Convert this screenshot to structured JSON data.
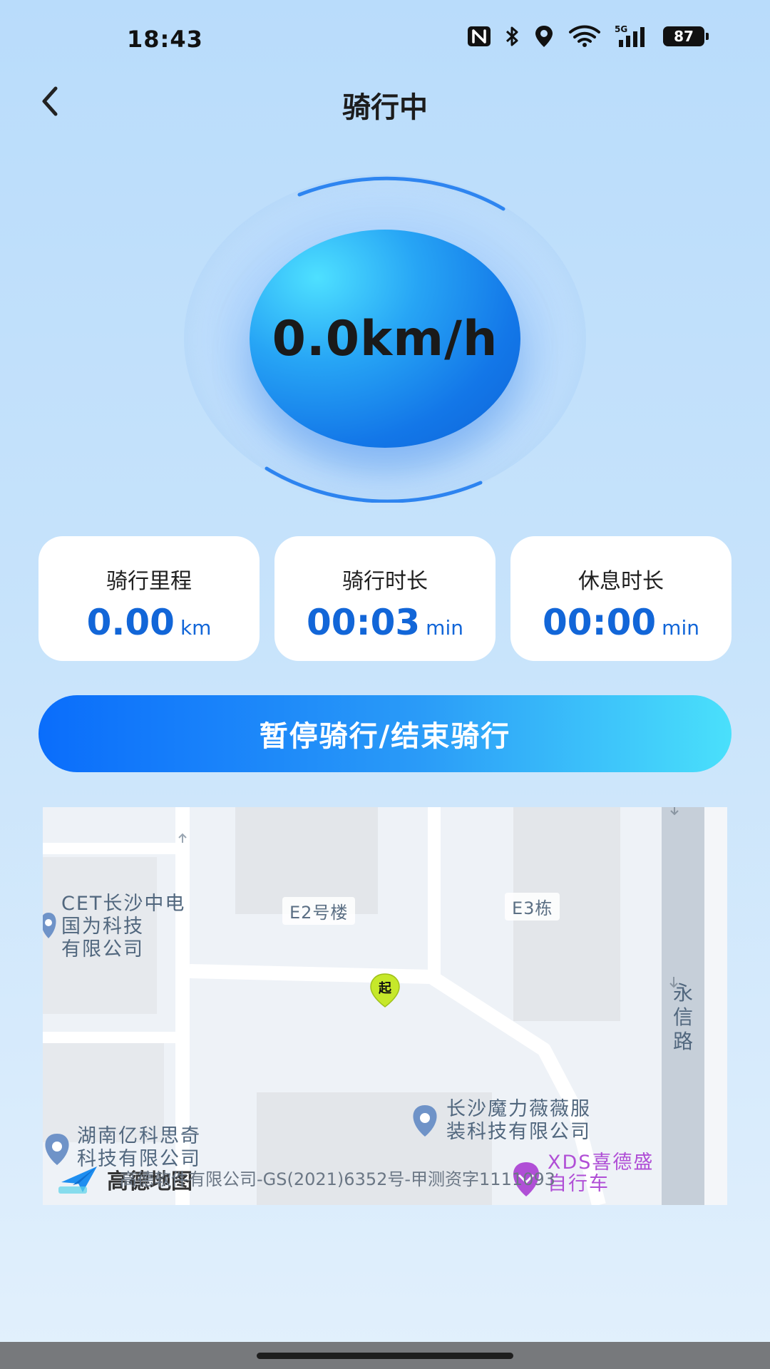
{
  "status_bar": {
    "time": "18:43",
    "network": "5G",
    "battery": "87",
    "icons": [
      "nfc-icon",
      "bluetooth-icon",
      "location-icon",
      "wifi-icon",
      "signal-icon",
      "battery-icon"
    ]
  },
  "header": {
    "title": "骑行中",
    "back_icon": "chevron-left-icon"
  },
  "speed": {
    "value": "0.0km/h"
  },
  "stats": [
    {
      "label": "骑行里程",
      "value": "0.00",
      "unit": "km"
    },
    {
      "label": "骑行时长",
      "value": "00:03",
      "unit": "min"
    },
    {
      "label": "休息时长",
      "value": "00:00",
      "unit": "min"
    }
  ],
  "action_button": {
    "label": "暂停骑行/结束骑行"
  },
  "map": {
    "poi_cet": "CET长沙中电国为科技有限公司",
    "poi_cet_lines": [
      "CET长沙中电",
      "国为科技",
      "有限公司"
    ],
    "tag_e2": "E2号楼",
    "tag_e3": "E3栋",
    "road_vertical": [
      "永",
      "信",
      "路"
    ],
    "start_marker": "起",
    "poi_mlww_lines": [
      "长沙魔力薇薇服",
      "装科技有限公司"
    ],
    "poi_hnyk_lines": [
      "湖南亿科思奇",
      "科技有限公司"
    ],
    "poi_xds_lines": [
      "XDS喜德盛",
      "自行车"
    ],
    "logo_text": "高德地图",
    "copyright": "高德软件有限公司-GS(2021)6352号-甲测资字1111093",
    "colors": {
      "start_marker": "#c6e82a",
      "poi_purple": "#b04fd6",
      "poi_blue": "#6f93c8"
    }
  },
  "colors": {
    "accent": "#1266d8",
    "button_start": "#0a6dfb",
    "button_end": "#4ae0fb"
  }
}
